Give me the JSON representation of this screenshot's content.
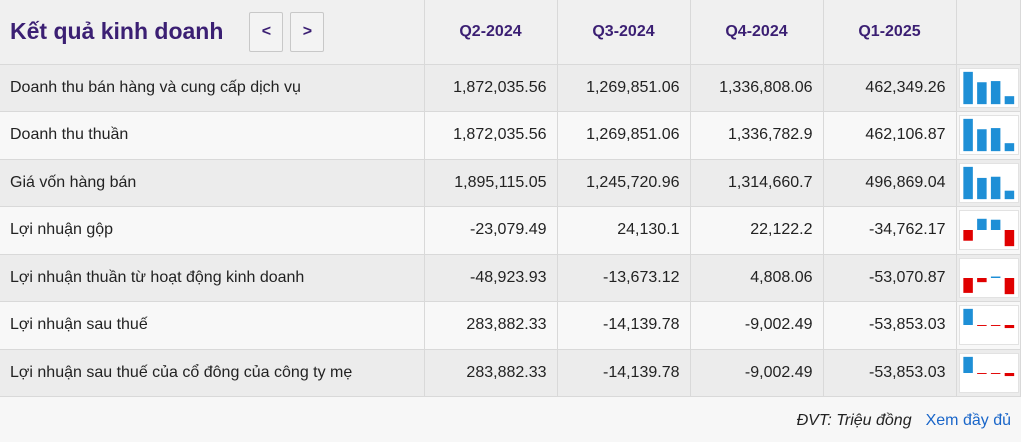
{
  "header": {
    "title": "Kết quả kinh doanh",
    "prev_label": "<",
    "next_label": ">",
    "periods": [
      "Q2-2024",
      "Q3-2024",
      "Q4-2024",
      "Q1-2025"
    ]
  },
  "colors": {
    "positive": "#1e8fd6",
    "negative": "#e00000",
    "header_text": "#3b1f73",
    "link": "#1a66c9"
  },
  "rows": [
    {
      "label": "Doanh thu bán hàng và cung cấp dịch vụ",
      "display": [
        "1,872,035.56",
        "1,269,851.06",
        "1,336,808.06",
        "462,349.26"
      ],
      "values": [
        1872035.56,
        1269851.06,
        1336808.06,
        462349.26
      ]
    },
    {
      "label": "Doanh thu thuần",
      "display": [
        "1,872,035.56",
        "1,269,851.06",
        "1,336,782.9",
        "462,106.87"
      ],
      "values": [
        1872035.56,
        1269851.06,
        1336782.9,
        462106.87
      ]
    },
    {
      "label": "Giá vốn hàng bán",
      "display": [
        "1,895,115.05",
        "1,245,720.96",
        "1,314,660.7",
        "496,869.04"
      ],
      "values": [
        1895115.05,
        1245720.96,
        1314660.7,
        496869.04
      ]
    },
    {
      "label": "Lợi nhuận gộp",
      "display": [
        "-23,079.49",
        "24,130.1",
        "22,122.2",
        "-34,762.17"
      ],
      "values": [
        -23079.49,
        24130.1,
        22122.2,
        -34762.17
      ]
    },
    {
      "label": "Lợi nhuận thuần từ hoạt động kinh doanh",
      "display": [
        "-48,923.93",
        "-13,673.12",
        "4,808.06",
        "-53,070.87"
      ],
      "values": [
        -48923.93,
        -13673.12,
        4808.06,
        -53070.87
      ]
    },
    {
      "label": "Lợi nhuận sau thuế",
      "display": [
        "283,882.33",
        "-14,139.78",
        "-9,002.49",
        "-53,853.03"
      ],
      "values": [
        283882.33,
        -14139.78,
        -9002.49,
        -53853.03
      ]
    },
    {
      "label": "Lợi nhuận sau thuế của cổ đông của công ty mẹ",
      "display": [
        "283,882.33",
        "-14,139.78",
        "-9,002.49",
        "-53,853.03"
      ],
      "values": [
        283882.33,
        -14139.78,
        -9002.49,
        -53853.03
      ]
    }
  ],
  "footer": {
    "unit": "ĐVT: Triệu đồng",
    "more_link": "Xem đầy đủ"
  }
}
